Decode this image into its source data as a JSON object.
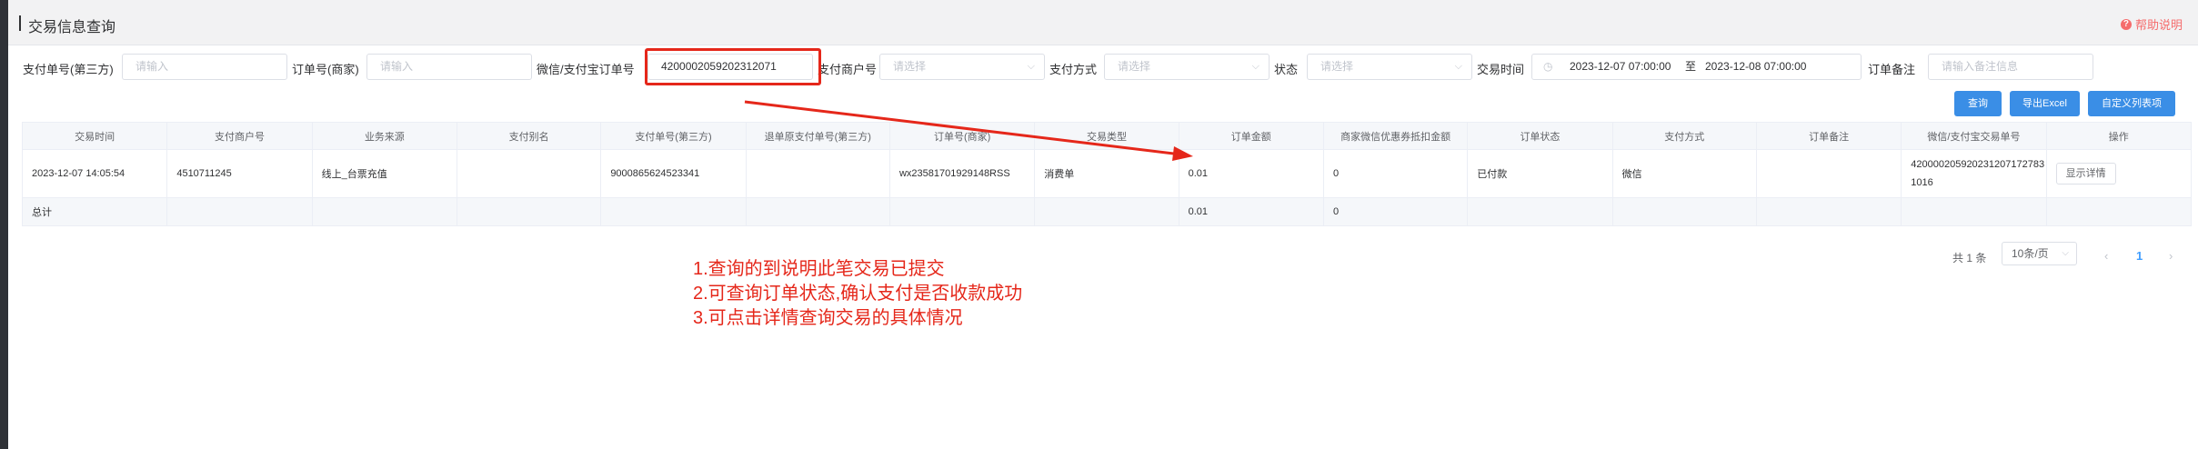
{
  "header": {
    "title": "交易信息查询",
    "help": "帮助说明"
  },
  "filters": {
    "pay_no_label": "支付单号(第三方)",
    "pay_no_placeholder": "请输入",
    "order_no_label": "订单号(商家)",
    "order_no_placeholder": "请输入",
    "wx_order_label": "微信/支付宝订单号",
    "wx_order_value": "4200002059202312071",
    "merchant_label": "支付商户号",
    "merchant_placeholder": "请选择",
    "pay_method_label": "支付方式",
    "pay_method_placeholder": "请选择",
    "status_label": "状态",
    "status_placeholder": "请选择",
    "trade_time_label": "交易时间",
    "date_start": "2023-12-07 07:00:00",
    "date_sep": "至",
    "date_end": "2023-12-08 07:00:00",
    "remark_label": "订单备注",
    "remark_placeholder": "请输入备注信息"
  },
  "buttons": {
    "query": "查询",
    "export": "导出Excel",
    "columns": "自定义列表项"
  },
  "table": {
    "headers": [
      "交易时间",
      "支付商户号",
      "业务来源",
      "支付别名",
      "支付单号(第三方)",
      "退单原支付单号(第三方)",
      "订单号(商家)",
      "交易类型",
      "订单金额",
      "商家微信优惠券抵扣金额",
      "订单状态",
      "支付方式",
      "订单备注",
      "微信/支付宝交易单号",
      "操作"
    ],
    "row": {
      "trade_time": "2023-12-07 14:05:54",
      "merchant_no": "4510711245",
      "source": "线上_台票充值",
      "alias": "",
      "pay_no": "9000865624523341",
      "refund_no": "",
      "order_no": "wx23581701929148RSS",
      "trade_type": "消费单",
      "amount": "0.01",
      "coupon": "0",
      "status": "已付款",
      "method": "微信",
      "remark": "",
      "wx_trade_no": "4200002059202312071727831016",
      "action": "显示详情"
    },
    "total": {
      "label": "总计",
      "amount": "0.01",
      "coupon": "0"
    }
  },
  "notes": [
    "1.查询的到说明此笔交易已提交",
    "2.可查询订单状态,确认支付是否收款成功",
    "3.可点击详情查询交易的具体情况"
  ],
  "pagination": {
    "total": "共 1 条",
    "page_size": "10条/页",
    "prev": "‹",
    "current": "1",
    "next": "›"
  },
  "colors": {
    "accent": "#3a8ee6",
    "annotation": "#e5271a",
    "help": "#f56c6c"
  }
}
